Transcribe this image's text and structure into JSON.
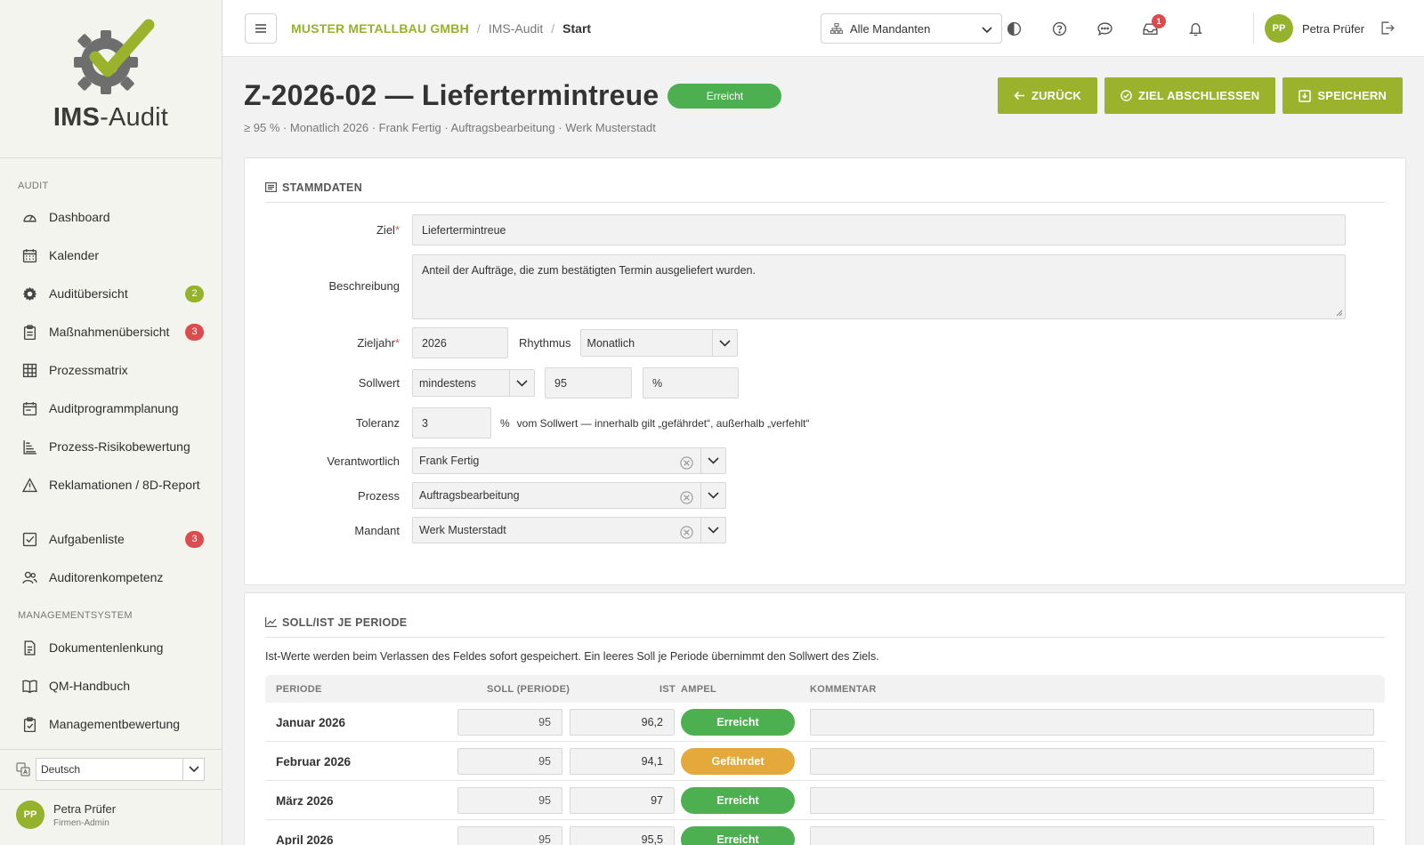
{
  "brand": {
    "logo_bold": "IMS",
    "logo_rest": "-Audit",
    "accent": "#95b22c"
  },
  "sidebar": {
    "section_audit": "AUDIT",
    "section_mgmt": "MANAGEMENTSYSTEM",
    "items": [
      {
        "label": "Dashboard",
        "icon": "dashboard-icon"
      },
      {
        "label": "Kalender",
        "icon": "calendar-icon"
      },
      {
        "label": "Auditübersicht",
        "icon": "gear-icon",
        "badge": "2"
      },
      {
        "label": "Maßnahmenübersicht",
        "icon": "clipboard-icon",
        "badge": "3"
      },
      {
        "label": "Prozessmatrix",
        "icon": "grid-icon"
      },
      {
        "label": "Auditprogrammplanung",
        "icon": "calendar-plan-icon"
      },
      {
        "label": "Prozess-Risikobewertung",
        "icon": "risk-list-icon"
      },
      {
        "label": "Reklamationen / 8D-Report",
        "icon": "warning-icon"
      },
      {
        "label": "Aufgabenliste",
        "icon": "checkbox-icon",
        "badge": "3"
      },
      {
        "label": "Auditorenkompetenz",
        "icon": "users-icon"
      }
    ],
    "mgmt_items": [
      {
        "label": "Dokumentenlenkung",
        "icon": "document-icon"
      },
      {
        "label": "QM-Handbuch",
        "icon": "book-icon"
      },
      {
        "label": "Managementbewertung",
        "icon": "clipboard-check-icon"
      }
    ],
    "language": "Deutsch",
    "user_name": "Petra Prüfer",
    "user_role": "Firmen-Admin",
    "user_initials": "PP"
  },
  "topbar": {
    "crumb_company": "MUSTER METALLBAU GMBH",
    "crumb_app": "IMS-Audit",
    "crumb_current": "Start",
    "tenant": "Alle Mandanten",
    "notification_badge": "1",
    "user_name": "Petra Prüfer",
    "user_initials": "PP"
  },
  "page": {
    "title": "Z-2026-02 — Liefertermintreue",
    "status": "Erreicht",
    "subtitle": "≥ 95 % · Monatlich 2026 · Frank Fertig · Auftragsbearbeitung · Werk Musterstadt",
    "btn_back": "ZURÜCK",
    "btn_close": "ZIEL ABSCHLIESSEN",
    "btn_save": "SPEICHERN"
  },
  "stammdaten": {
    "heading": "STAMMDATEN",
    "label_ziel": "Ziel",
    "ziel": "Liefertermintreue",
    "label_beschreibung": "Beschreibung",
    "beschreibung": "Anteil der Aufträge, die zum bestätigten Termin ausgeliefert wurden.",
    "label_zieljahr": "Zieljahr",
    "zieljahr": "2026",
    "label_rhythmus": "Rhythmus",
    "rhythmus": "Monatlich",
    "label_sollwert": "Sollwert",
    "sollwert_op": "mindestens",
    "sollwert": "95",
    "sollwert_unit": "%",
    "label_toleranz": "Toleranz",
    "toleranz": "3",
    "toleranz_unit": "%",
    "toleranz_hint": "vom Sollwert — innerhalb gilt „gefährdet“, außerhalb „verfehlt“",
    "label_verantwortlich": "Verantwortlich",
    "verantwortlich": "Frank Fertig",
    "label_prozess": "Prozess",
    "prozess": "Auftragsbearbeitung",
    "label_mandant": "Mandant",
    "mandant": "Werk Musterstadt"
  },
  "perioden": {
    "heading": "SOLL/IST JE PERIODE",
    "note": "Ist-Werte werden beim Verlassen des Feldes sofort gespeichert. Ein leeres Soll je Periode übernimmt den Sollwert des Ziels.",
    "columns": {
      "periode": "PERIODE",
      "soll": "SOLL (PERIODE)",
      "ist": "IST",
      "ampel": "AMPEL",
      "kommentar": "KOMMENTAR"
    },
    "rows": [
      {
        "periode": "Januar 2026",
        "soll": "95",
        "ist": "96,2",
        "ampel": "Erreicht",
        "color": "#4caf50"
      },
      {
        "periode": "Februar 2026",
        "soll": "95",
        "ist": "94,1",
        "ampel": "Gefährdet",
        "color": "#e4a93a"
      },
      {
        "periode": "März 2026",
        "soll": "95",
        "ist": "97",
        "ampel": "Erreicht",
        "color": "#4caf50"
      },
      {
        "periode": "April 2026",
        "soll": "95",
        "ist": "95,5",
        "ampel": "Erreicht",
        "color": "#4caf50"
      }
    ]
  }
}
